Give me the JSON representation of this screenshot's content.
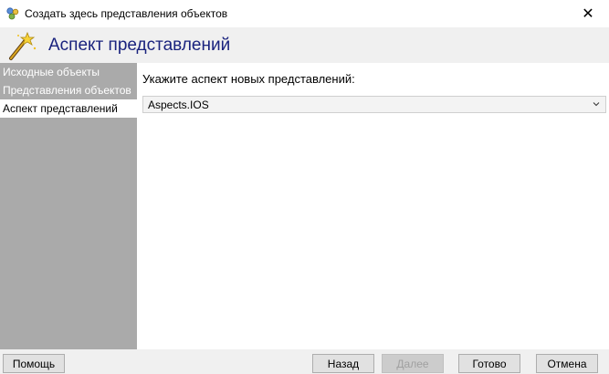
{
  "window": {
    "title": "Создать здесь представления объектов",
    "close_glyph": "✕"
  },
  "header": {
    "title": "Аспект представлений",
    "icon": "wizard-wand-icon"
  },
  "sidebar": {
    "items": [
      {
        "label": "Исходные объекты",
        "active": false
      },
      {
        "label": "Представления объектов",
        "active": false
      },
      {
        "label": "Аспект представлений",
        "active": true
      }
    ]
  },
  "main": {
    "prompt": "Укажите аспект новых представлений:",
    "aspect_select": {
      "value": "Aspects.IOS"
    }
  },
  "footer": {
    "help_label": "Помощь",
    "back_label": "Назад",
    "next_label": "Далее",
    "finish_label": "Готово",
    "cancel_label": "Отмена"
  },
  "colors": {
    "heading": "#1a237e",
    "sidebar_bg": "#aaaaaa",
    "sidebar_active_bg": "#ffffff"
  }
}
